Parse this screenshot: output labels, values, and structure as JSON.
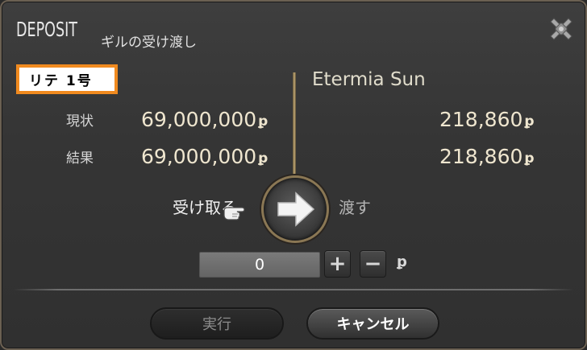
{
  "window": {
    "title": "DEPOSIT",
    "subtitle": "ギルの受け渡し"
  },
  "icons": {
    "close": "close-cross-icon",
    "arrow": "arrow-right-icon",
    "cursor": "pointing-hand-cursor-icon",
    "gil": "gil-currency-icon"
  },
  "self": {
    "name": "リテ 1号",
    "current_label": "現状",
    "result_label": "結果",
    "current_amount": "69,000,000",
    "result_amount": "69,000,000"
  },
  "partner": {
    "name": "Etermia Sun",
    "current_amount": "218,860",
    "result_amount": "218,860"
  },
  "gil_symbol": "ꝑ",
  "direction": {
    "receive_label": "受け取る",
    "give_label": "渡す"
  },
  "amount_input": {
    "value": "0"
  },
  "stepper": {
    "plus": "+",
    "minus": "−"
  },
  "buttons": {
    "execute": "実行",
    "cancel": "キャンセル"
  },
  "colors": {
    "badge_border": "#f08a1f",
    "accent_gold": "#c4ac78",
    "amount_text": "#efe6cf"
  }
}
